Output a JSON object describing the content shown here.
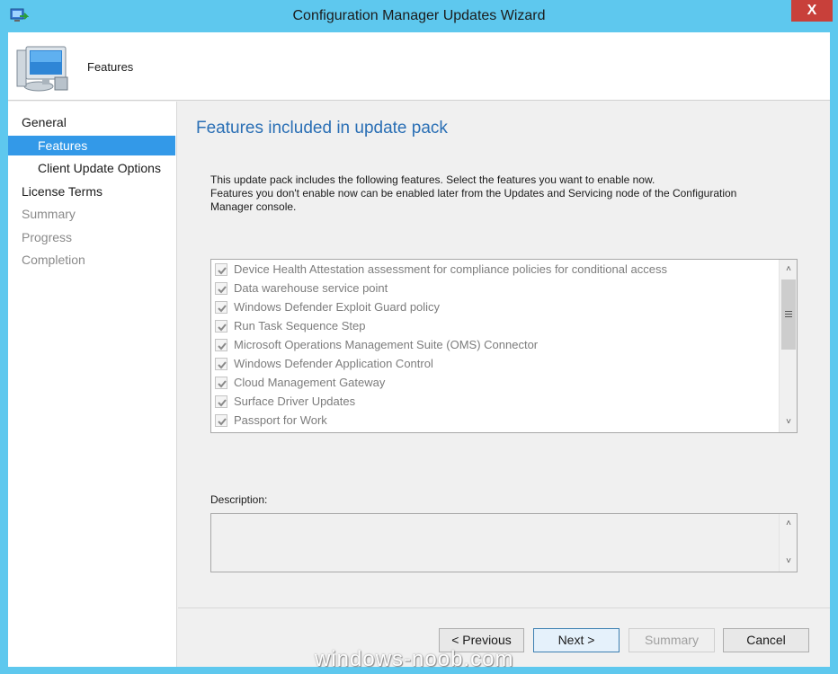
{
  "window": {
    "title": "Configuration Manager Updates Wizard",
    "close_glyph": "X",
    "accent": "#5ec8ee"
  },
  "header": {
    "title": "Features",
    "icon": "computer-icon"
  },
  "nav": {
    "items": [
      {
        "label": "General",
        "level": "top",
        "state": "normal"
      },
      {
        "label": "Features",
        "level": "sub",
        "state": "selected"
      },
      {
        "label": "Client Update Options",
        "level": "sub",
        "state": "normal"
      },
      {
        "label": "License Terms",
        "level": "top",
        "state": "normal"
      },
      {
        "label": "Summary",
        "level": "top",
        "state": "disabled"
      },
      {
        "label": "Progress",
        "level": "top",
        "state": "disabled"
      },
      {
        "label": "Completion",
        "level": "top",
        "state": "disabled"
      }
    ],
    "selected_color": "#3399e8"
  },
  "content": {
    "heading": "Features included in update pack",
    "intro_line1": "This update pack includes the following features. Select the features you want to enable now.",
    "intro_line2": "Features you don't enable now can be enabled later from the Updates and Servicing node of the Configuration Manager console.",
    "features": [
      {
        "label": "Device Health Attestation assessment for compliance policies for conditional access",
        "checked": true
      },
      {
        "label": "Data warehouse service point",
        "checked": true
      },
      {
        "label": "Windows Defender Exploit Guard policy",
        "checked": true
      },
      {
        "label": "Run Task Sequence Step",
        "checked": true
      },
      {
        "label": "Microsoft Operations Management Suite (OMS) Connector",
        "checked": true
      },
      {
        "label": "Windows Defender Application Control",
        "checked": true
      },
      {
        "label": "Cloud Management Gateway",
        "checked": true
      },
      {
        "label": "Surface Driver Updates",
        "checked": true
      },
      {
        "label": "Passport for Work",
        "checked": true
      }
    ],
    "description_label": "Description:",
    "description_value": ""
  },
  "buttons": {
    "previous": "< Previous",
    "next": "Next >",
    "summary": "Summary",
    "cancel": "Cancel"
  },
  "watermark": "windows-noob.com"
}
